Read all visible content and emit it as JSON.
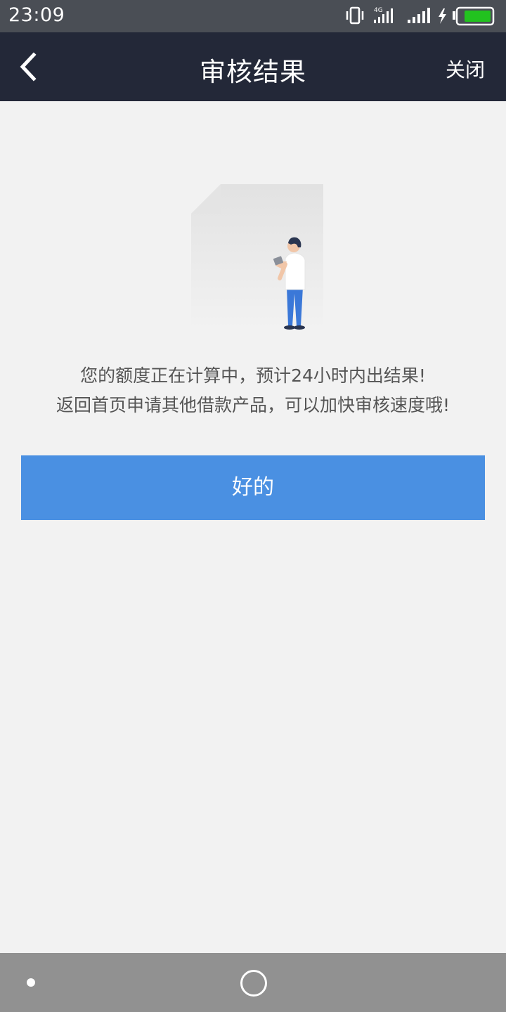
{
  "status_bar": {
    "time": "23:09",
    "network_label": "4G",
    "icons": [
      "vibrate-icon",
      "signal-4g-icon",
      "signal-icon",
      "charging-icon",
      "battery-icon"
    ],
    "battery_color": "#22c21f"
  },
  "nav": {
    "back_icon": "chevron-left-icon",
    "title": "审核结果",
    "close_label": "关闭",
    "background": "#232838"
  },
  "main": {
    "illustration_icon": "document-person-illustration",
    "message_line1": "您的额度正在计算中，预计24小时内出结果!",
    "message_line2": "返回首页申请其他借款产品，可以加快审核速度哦!",
    "ok_button_label": "好的",
    "accent": "#4a90e2"
  },
  "system_nav": {
    "icons": [
      "dot-icon",
      "home-circle-icon"
    ]
  }
}
